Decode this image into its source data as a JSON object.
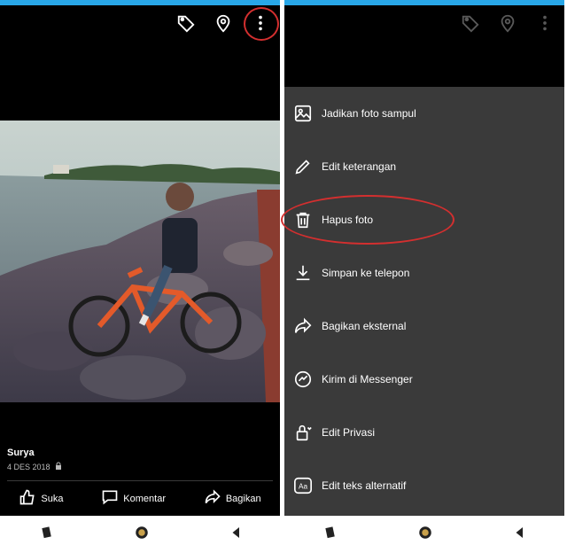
{
  "left_screen": {
    "post": {
      "owner": "Surya",
      "date": "4 DES 2018"
    },
    "actions": [
      {
        "icon": "like-icon",
        "label": "Suka"
      },
      {
        "icon": "comment-icon",
        "label": "Komentar"
      },
      {
        "icon": "share-icon",
        "label": "Bagikan"
      }
    ],
    "top_icons": [
      "tag-icon",
      "location-icon",
      "more-options-icon"
    ]
  },
  "right_screen": {
    "menu": [
      {
        "icon": "image-icon",
        "label": "Jadikan foto sampul"
      },
      {
        "icon": "pencil-icon",
        "label": "Edit keterangan"
      },
      {
        "icon": "trash-icon",
        "label": "Hapus foto"
      },
      {
        "icon": "download-icon",
        "label": "Simpan ke telepon"
      },
      {
        "icon": "share-icon",
        "label": "Bagikan eksternal"
      },
      {
        "icon": "messenger-icon",
        "label": "Kirim di Messenger"
      },
      {
        "icon": "lock-icon",
        "label": "Edit Privasi"
      },
      {
        "icon": "alt-text-icon",
        "label": "Edit teks alternatif"
      }
    ]
  },
  "colors": {
    "statusbar": "#28a7e8",
    "highlight": "#d32f2f",
    "menu_bg": "#3a3a3a"
  },
  "navbar": [
    "recent-apps-icon",
    "home-icon",
    "back-icon"
  ]
}
